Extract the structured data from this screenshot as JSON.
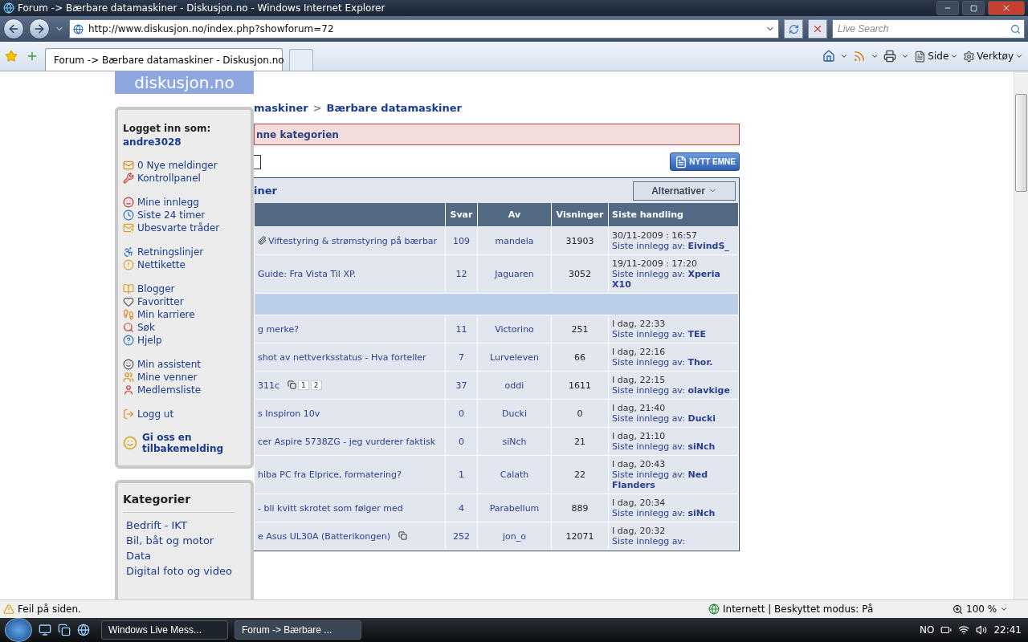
{
  "browser": {
    "title": "Forum -> Bærbare datamaskiner - Diskusjon.no - Windows Internet Explorer",
    "address": "http://www.diskusjon.no/index.php?showforum=72",
    "search": {
      "placeholder": "Live Search"
    },
    "tab": "Forum -> Bærbare datamaskiner - Diskusjon.no",
    "tools": [
      "Side",
      "Verktøy"
    ]
  },
  "page": {
    "logo": "diskusjon.no",
    "user_menu": {
      "label": "Logget inn som:",
      "user": "andre3028",
      "groups": [
        [
          "0 Nye meldinger",
          "Kontrollpanel"
        ],
        [
          "Mine innlegg",
          "Siste 24 timer",
          "Ubesvarte tråder"
        ],
        [
          "Retningslinjer",
          "Nettikette"
        ],
        [
          "Blogger",
          "Favoritter",
          "Min karriere",
          "Søk",
          "Hjelp"
        ],
        [
          "Min assistent",
          "Mine venner",
          "Medlemsliste"
        ],
        [
          "Logg ut"
        ]
      ],
      "feedback": "Gi oss en tilbakemelding"
    },
    "categories": {
      "title": "Kategorier",
      "items": [
        "Bedrift - IKT",
        "Bil, båt og motor",
        "Data",
        "Digital foto og video"
      ]
    },
    "breadcrumb": [
      "maskiner",
      "Bærbare datamaskiner"
    ],
    "breadcrumb_separator": ">",
    "notice": "nne kategorien",
    "new_topic_button": "NYTT EMNE",
    "forum_title": "iner",
    "options_button": "Alternativer",
    "table": {
      "columns": [
        "Svar",
        "Av",
        "Visninger",
        "Siste handling"
      ],
      "rows": [
        {
          "kind": "topic",
          "attachment": true,
          "title": "Viftestyring & strømstyring på bærbar",
          "svar": "109",
          "av": "mandela",
          "visninger": "31903",
          "date": "30/11-2009 : 16:57",
          "last_label": "Siste innlegg av:",
          "last_by": "EivindS_"
        },
        {
          "kind": "topic",
          "title": "Guide: Fra Vista Til XP.",
          "svar": "12",
          "av": "Jaguaren",
          "visninger": "3052",
          "date": "19/11-2009 : 17:20",
          "last_label": "Siste innlegg av:",
          "last_by": "Xperia X10"
        },
        {
          "kind": "section"
        },
        {
          "kind": "topic",
          "title": "g merke?",
          "svar": "11",
          "av": "Victorino",
          "visninger": "251",
          "date": "I dag, 22:33",
          "last_label": "Siste innlegg av:",
          "last_by": "TEE"
        },
        {
          "kind": "topic",
          "title": "shot av nettverksstatus - Hva forteller",
          "svar": "7",
          "av": "Lurveleven",
          "visninger": "66",
          "date": "I dag, 22:16",
          "last_label": "Siste innlegg av:",
          "last_by": "Thor."
        },
        {
          "kind": "topic",
          "title": "311c",
          "multipage": true,
          "pages": [
            "1",
            "2"
          ],
          "svar": "37",
          "av": "oddi",
          "visninger": "1611",
          "date": "I dag, 22:15",
          "last_label": "Siste innlegg av:",
          "last_by": "olavkige"
        },
        {
          "kind": "topic",
          "title": "s Inspiron 10v",
          "svar": "0",
          "av": "Ducki",
          "visninger": "0",
          "date": "I dag, 21:40",
          "last_label": "Siste innlegg av:",
          "last_by": "Ducki"
        },
        {
          "kind": "topic",
          "title": "cer Aspire 5738ZG - jeg vurderer faktisk",
          "svar": "0",
          "av": "siNch",
          "visninger": "21",
          "date": "I dag, 21:10",
          "last_label": "Siste innlegg av:",
          "last_by": "siNch"
        },
        {
          "kind": "topic",
          "title": "hiba PC fra Elprice, formatering?",
          "svar": "1",
          "av": "Calath",
          "visninger": "22",
          "date": "I dag, 20:43",
          "last_label": "Siste innlegg av:",
          "last_by": "Ned Flanders"
        },
        {
          "kind": "topic",
          "title": "- bli kvitt skrotet som følger med",
          "svar": "4",
          "av": "Parabellum",
          "visninger": "889",
          "date": "I dag, 20:34",
          "last_label": "Siste innlegg av:",
          "last_by": "siNch"
        },
        {
          "kind": "topic",
          "title": "e Asus UL30A (Batterikongen)",
          "multipage": true,
          "svar": "252",
          "av": "jon_o",
          "visninger": "12071",
          "date": "I dag, 20:32",
          "last_label": "Siste innlegg av:"
        }
      ]
    }
  },
  "status_bar": {
    "message": "Feil på siden.",
    "zone": "Internett | Beskyttet modus: På",
    "zoom": "100 %"
  },
  "taskbar": {
    "buttons": [
      {
        "label": "Windows Live Mess...",
        "selected": false
      },
      {
        "label": "Forum -> Bærbare ...",
        "selected": true
      }
    ],
    "language": "NO",
    "clock": "22:41"
  }
}
